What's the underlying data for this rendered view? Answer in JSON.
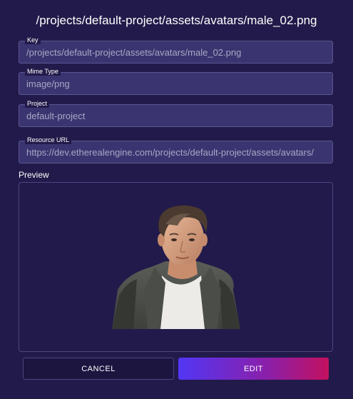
{
  "dialog": {
    "title": "/projects/default-project/assets/avatars/male_02.png"
  },
  "fields": [
    {
      "label": "Key",
      "value": "/projects/default-project/assets/avatars/male_02.png"
    },
    {
      "label": "Mime Type",
      "value": "image/png"
    },
    {
      "label": "Project",
      "value": "default-project"
    },
    {
      "label": "Resource URL",
      "value": "https://dev.etherealengine.com/projects/default-project/assets/avatars/"
    }
  ],
  "preview": {
    "label": "Preview",
    "image_subject": "male avatar portrait"
  },
  "actions": {
    "cancel_label": "CANCEL",
    "edit_label": "EDIT"
  },
  "colors": {
    "background": "#221a4a",
    "field_bg": "#3a3570",
    "edit_gradient_start": "#5236f5",
    "edit_gradient_end": "#c3115f"
  }
}
